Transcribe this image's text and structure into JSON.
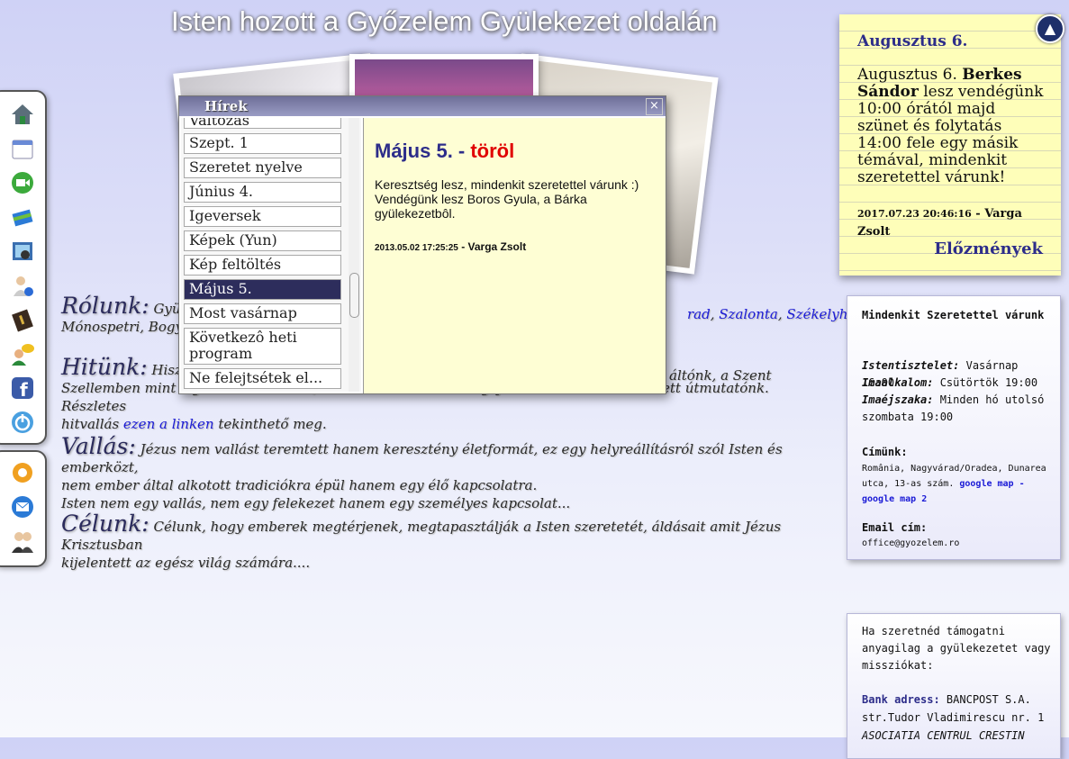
{
  "header": {
    "title": "Isten hozott a Győzelem Gyülekezet oldalán"
  },
  "dock": {
    "icons": [
      "home-icon",
      "calendar-icon",
      "video-icon",
      "books-icon",
      "photo-camera-icon",
      "user-info-icon",
      "bible-icon",
      "chat-users-icon",
      "facebook-icon",
      "power-icon"
    ],
    "icons2": [
      "settings-icon",
      "mail-icon",
      "users-icon"
    ]
  },
  "sections": {
    "rolunk": {
      "heading": "Rólunk:",
      "lead": "Gyülekezetünk",
      "link1": "rad",
      "sep1": ", ",
      "link2": "Szalonta",
      "sep2": ", ",
      "link3": "Székelyhíd",
      "line2": "Mónospetri, Bogy"
    },
    "hitunk": {
      "heading": "Hitünk:",
      "text1": "Hisz",
      "text1b": "áltónk, a Szent",
      "text2": "Szellemben mint vigasztaló és tanító, a Bibliában mint Isten igéjében amit Istentől ihletett útmutatónk. Részletes",
      "text3a": "hitvallás ",
      "link": "ezen a linken",
      "text3b": " tekinthető meg."
    },
    "vallas": {
      "heading": "Vallás:",
      "text1": "Jézus nem vallást teremtett hanem keresztény életformát, ez egy helyreállításról szól Isten és emberközt,",
      "text2": "nem ember által alkotott tradiciókra épül hanem egy élő kapcsolatra.",
      "text3": "Isten nem egy vallás, nem egy felekezet hanem egy személyes kapcsolat..."
    },
    "celunk": {
      "heading": "Célunk:",
      "text1": "Célunk, hogy emberek megtérjenek, megtapasztálják a Isten szeretetét, áldásait amit Jézus Krisztusban",
      "text2": "kijelentett az egész világ számára...."
    }
  },
  "news_window": {
    "title": "Hírek",
    "close": "×",
    "items": [
      {
        "label": "Változás"
      },
      {
        "label": "Szept. 1"
      },
      {
        "label": "Szeretet nyelve"
      },
      {
        "label": "Június 4."
      },
      {
        "label": "Igeversek"
      },
      {
        "label": "Képek (Yun)"
      },
      {
        "label": "Kép feltöltés"
      },
      {
        "label": "Május 5."
      },
      {
        "label": "Most vasárnap"
      },
      {
        "label": "Következô heti program"
      },
      {
        "label": "Ne felejtsétek el..."
      }
    ],
    "selected": "Május 5.",
    "content": {
      "title": "Május 5. - ",
      "title_action": "töröl",
      "body": "Keresztség lesz, mindenkit szeretettel várunk :) Vendégünk lesz Boros Gyula, a Bárka gyülekezetbôl.",
      "date": "2013.05.02 17:25:25",
      "author": " - Varga Zsolt"
    }
  },
  "note": {
    "heading": "Augusztus 6.",
    "body_pre": "Augusztus 6. ",
    "body_bold": "Berkes Sándor",
    "body_post": " lesz vendégünk 10:00 órától majd szünet és folytatás 14:00 fele egy másik témával, mindenkit szeretettel várunk!",
    "timestamp": "2017.07.23 20:46:16",
    "author": " - Varga Zsolt",
    "history_link": "Előzmények",
    "up_button": "▲"
  },
  "info_box": {
    "greeting": "Mindenkit Szeretettel várunk",
    "service_label": "Istentisztelet:",
    "service_value": " Vasárnap 16:00",
    "prayer_label": "Imaalkalom:",
    "prayer_value": " Csütörtök 19:00",
    "night_label": "Imaéjszaka:",
    "night_value": " Minden hó utolsó szombata 19:00",
    "address_label": "Címünk:",
    "address": "România, Nagyvárad/Oradea, Dunarea utca, 13-as szám. ",
    "map1": "google map",
    "map_sep": " - ",
    "map2": "google map 2",
    "email_label": "Email cím:",
    "email": "office@gyozelem.ro"
  },
  "support_box": {
    "text": "Ha szeretnéd támogatni anyagilag a gyülekezetet vagy missziókat:",
    "bank_label": "Bank adress:",
    "bank_value": " BANCPOST S.A.",
    "street": "str.Tudor Vladimirescu nr. 1",
    "account_name": "ASOCIATIA CENTRUL CRESTIN"
  }
}
